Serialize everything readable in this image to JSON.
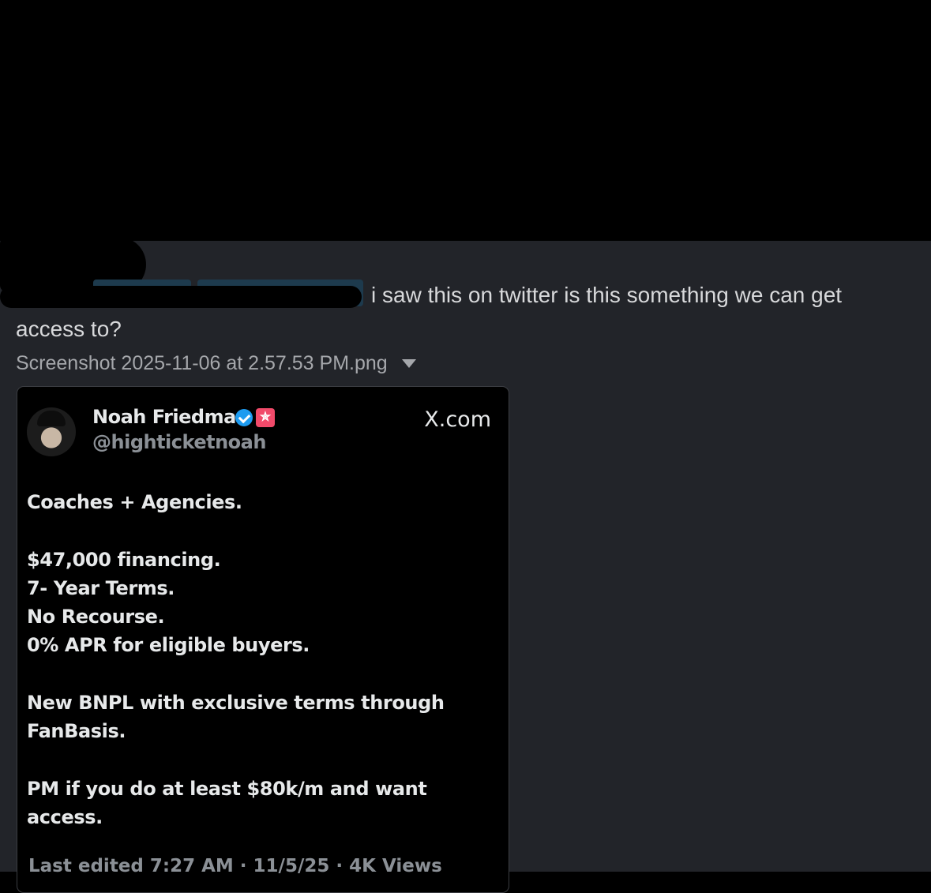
{
  "message": {
    "mentions": [
      "",
      ""
    ],
    "text_line1": "i saw this on twitter is this something we can get",
    "text_line2": "access to?"
  },
  "attachment": {
    "filename": "Screenshot 2025-11-06 at 2.57.53 PM.png"
  },
  "tweet": {
    "author_name": "Noah Friedman",
    "author_handle": "@highticketnoah",
    "source": "X.com",
    "affiliate_badge": "✮",
    "lines": [
      [
        "Coaches + Agencies."
      ],
      [
        "$47,000 financing.",
        "7- Year Terms.",
        "No Recourse.",
        "0% APR for eligible buyers."
      ],
      [
        "New BNPL with exclusive terms through",
        "FanBasis."
      ],
      [
        "PM if you do at least $80k/m and want",
        "access."
      ]
    ],
    "meta": "Last edited 7:27 AM · 11/5/25 · 4K Views"
  }
}
